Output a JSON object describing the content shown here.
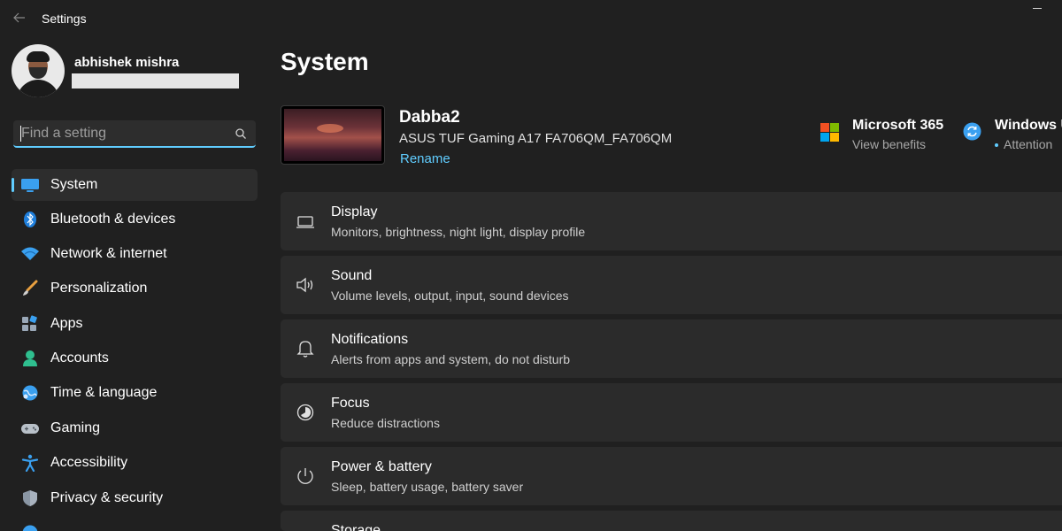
{
  "window": {
    "title": "Settings"
  },
  "user": {
    "name": "abhishek mishra"
  },
  "search": {
    "placeholder": "Find a setting"
  },
  "sidebar": {
    "items": [
      {
        "label": "System",
        "icon": "system-icon",
        "active": true
      },
      {
        "label": "Bluetooth & devices",
        "icon": "bluetooth-icon"
      },
      {
        "label": "Network & internet",
        "icon": "network-icon"
      },
      {
        "label": "Personalization",
        "icon": "brush-icon"
      },
      {
        "label": "Apps",
        "icon": "apps-icon"
      },
      {
        "label": "Accounts",
        "icon": "accounts-icon"
      },
      {
        "label": "Time & language",
        "icon": "globe-icon"
      },
      {
        "label": "Gaming",
        "icon": "gamepad-icon"
      },
      {
        "label": "Accessibility",
        "icon": "accessibility-icon"
      },
      {
        "label": "Privacy & security",
        "icon": "shield-icon"
      }
    ]
  },
  "main": {
    "title": "System",
    "device": {
      "name": "Dabba2",
      "model": "ASUS TUF Gaming A17 FA706QM_FA706QM",
      "rename_label": "Rename"
    },
    "promos": [
      {
        "title": "Microsoft 365",
        "subtitle": "View benefits",
        "icon": "microsoft-logo-icon"
      },
      {
        "title": "Windows U",
        "subtitle": "Attention",
        "icon": "sync-icon"
      }
    ],
    "cards": [
      {
        "title": "Display",
        "description": "Monitors, brightness, night light, display profile",
        "icon": "display-icon"
      },
      {
        "title": "Sound",
        "description": "Volume levels, output, input, sound devices",
        "icon": "speaker-icon"
      },
      {
        "title": "Notifications",
        "description": "Alerts from apps and system, do not disturb",
        "icon": "bell-icon"
      },
      {
        "title": "Focus",
        "description": "Reduce distractions",
        "icon": "focus-icon"
      },
      {
        "title": "Power & battery",
        "description": "Sleep, battery usage, battery saver",
        "icon": "power-icon"
      },
      {
        "title": "Storage",
        "description": "",
        "icon": "storage-icon"
      }
    ]
  },
  "colors": {
    "background": "#202020",
    "card": "#2b2b2b",
    "accent": "#60cdff",
    "text_secondary": "#cfcfcf"
  }
}
